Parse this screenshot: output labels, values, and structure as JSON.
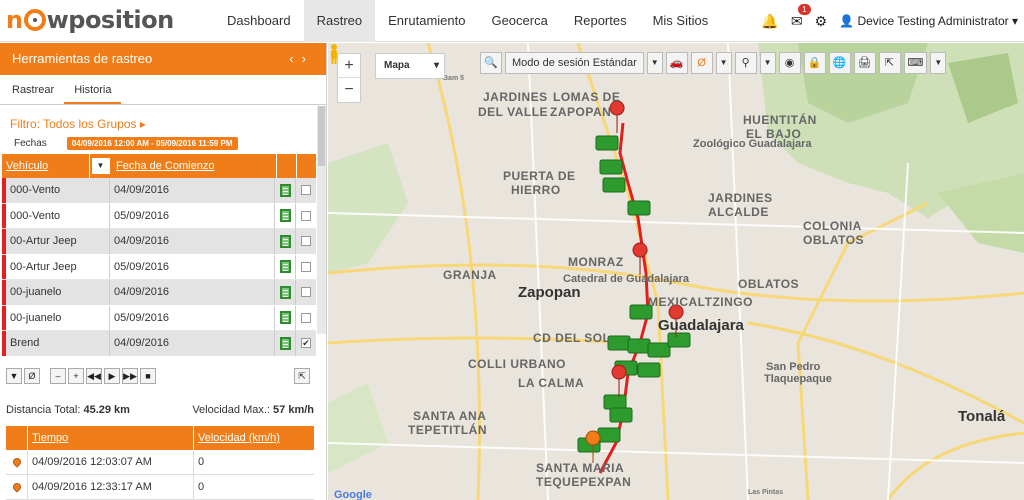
{
  "app": {
    "logo_text": "nowposition",
    "menu": [
      "Dashboard",
      "Rastreo",
      "Enrutamiento",
      "Geocerca",
      "Reportes",
      "Mis Sitios"
    ],
    "active_menu": "Rastreo",
    "notifications_badge": "1",
    "user_label": "Device Testing Administrator"
  },
  "panel": {
    "title": "Herramientas de rastreo",
    "tabs": [
      "Rastrear",
      "Historia"
    ],
    "active_tab": "Historia",
    "filter_label": "Filtro: Todos los Grupos",
    "dates_label": "Fechas",
    "dates_range": "04/09/2016 12:00 AM - 05/09/2016 11:59 PM",
    "columns": {
      "vehicle": "Vehículo",
      "start_date": "Fecha de Comienzo"
    },
    "rows": [
      {
        "vehicle": "000-Vento",
        "date": "04/09/2016",
        "checked": false
      },
      {
        "vehicle": "000-Vento",
        "date": "05/09/2016",
        "checked": false
      },
      {
        "vehicle": "00-Artur Jeep",
        "date": "04/09/2016",
        "checked": false
      },
      {
        "vehicle": "00-Artur Jeep",
        "date": "05/09/2016",
        "checked": false
      },
      {
        "vehicle": "00-juanelo",
        "date": "04/09/2016",
        "checked": false
      },
      {
        "vehicle": "00-juanelo",
        "date": "05/09/2016",
        "checked": false
      },
      {
        "vehicle": "Brend",
        "date": "04/09/2016",
        "checked": true
      }
    ],
    "stats": {
      "distance_label": "Distancia Total:",
      "distance_value": "45.29 km",
      "maxspeed_label": "Velocidad Max.:",
      "maxspeed_value": "57 km/h"
    },
    "track_columns": {
      "time": "Tiempo",
      "speed": "Velocidad (km/h)"
    },
    "track_rows": [
      {
        "time": "04/09/2016 12:03:07 AM",
        "speed": "0"
      },
      {
        "time": "04/09/2016 12:33:17 AM",
        "speed": "0"
      }
    ]
  },
  "map": {
    "type_select": "Mapa",
    "session_mode": "Modo de sesión Estándar",
    "labels": [
      {
        "text": "Bam 5",
        "cls": "ml-sm"
      },
      {
        "text": "JARDINES",
        "cls": "ml-big"
      },
      {
        "text": "DEL VALLE",
        "cls": "ml-big"
      },
      {
        "text": "LOMAS DE",
        "cls": "ml-big"
      },
      {
        "text": "ZAPOPAN",
        "cls": "ml-big"
      },
      {
        "text": "HUENTITÁN",
        "cls": "ml-big"
      },
      {
        "text": "EL BAJO",
        "cls": "ml-big"
      },
      {
        "text": "Zoológico Guadalajara",
        "cls": "ml-med"
      },
      {
        "text": "PUERTA DE",
        "cls": "ml-big"
      },
      {
        "text": "HIERRO",
        "cls": "ml-big"
      },
      {
        "text": "JARDINES",
        "cls": "ml-big"
      },
      {
        "text": "ALCALDE",
        "cls": "ml-big"
      },
      {
        "text": "COLONIA",
        "cls": "ml-big"
      },
      {
        "text": "OBLATOS",
        "cls": "ml-big"
      },
      {
        "text": "GRANJA",
        "cls": "ml-big"
      },
      {
        "text": "MONRAZ",
        "cls": "ml-big"
      },
      {
        "text": "Catedral de Guadalajara",
        "cls": "ml-med"
      },
      {
        "text": "OBLATOS",
        "cls": "ml-big"
      },
      {
        "text": "Zapopan",
        "cls": "ml-city"
      },
      {
        "text": "MEXICALTZINGO",
        "cls": "ml-big"
      },
      {
        "text": "Guadalajara",
        "cls": "ml-city"
      },
      {
        "text": "CD DEL SOL",
        "cls": "ml-big"
      },
      {
        "text": "San Pedro",
        "cls": "ml-med"
      },
      {
        "text": "Tlaquepaque",
        "cls": "ml-med"
      },
      {
        "text": "COLLI URBANO",
        "cls": "ml-big"
      },
      {
        "text": "LA CALMA",
        "cls": "ml-big"
      },
      {
        "text": "SANTA ANA",
        "cls": "ml-big"
      },
      {
        "text": "TEPETITLÁN",
        "cls": "ml-big"
      },
      {
        "text": "Tonalá",
        "cls": "ml-city"
      },
      {
        "text": "SANTA MARIA",
        "cls": "ml-big"
      },
      {
        "text": "TEQUEPEXPAN",
        "cls": "ml-big"
      },
      {
        "text": "Las Pintas",
        "cls": "ml-sm"
      },
      {
        "text": "Google",
        "cls": "ml-med"
      }
    ]
  }
}
